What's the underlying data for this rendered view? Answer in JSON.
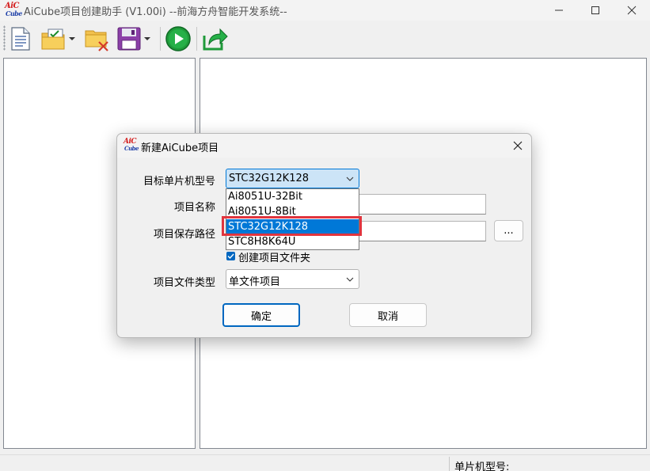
{
  "window": {
    "title": "AiCube项目创建助手 (V1.00i) --前海方舟智能开发系统--",
    "logo_top": "AiC",
    "logo_bottom": "Cube"
  },
  "toolbar": {
    "items": [
      "new-file-icon",
      "open-checklist-icon",
      "delete-folder-icon",
      "save-icon",
      "run-icon",
      "export-icon"
    ]
  },
  "statusbar": {
    "mcu_label": "单片机型号:"
  },
  "dialog": {
    "title": "新建AiCube项目",
    "mcu_model_label": "目标单片机型号",
    "mcu_model_value": "STC32G12K128",
    "project_name_label": "项目名称",
    "save_path_label": "项目保存路径",
    "browse_label": "...",
    "create_folder_label": "创建项目文件夹",
    "create_folder_checked": true,
    "file_type_label": "项目文件类型",
    "file_type_value": "单文件项目",
    "ok_label": "确定",
    "cancel_label": "取消"
  },
  "dropdown": {
    "options": [
      "Ai8051U-32Bit",
      "Ai8051U-8Bit",
      "STC32G12K128",
      "STC8H8K64U"
    ],
    "selected": "STC32G12K128"
  },
  "colors": {
    "selection": "#0078d7",
    "highlight": "#e0353e",
    "logo_red": "#d42020",
    "logo_blue": "#1d3fa8"
  }
}
